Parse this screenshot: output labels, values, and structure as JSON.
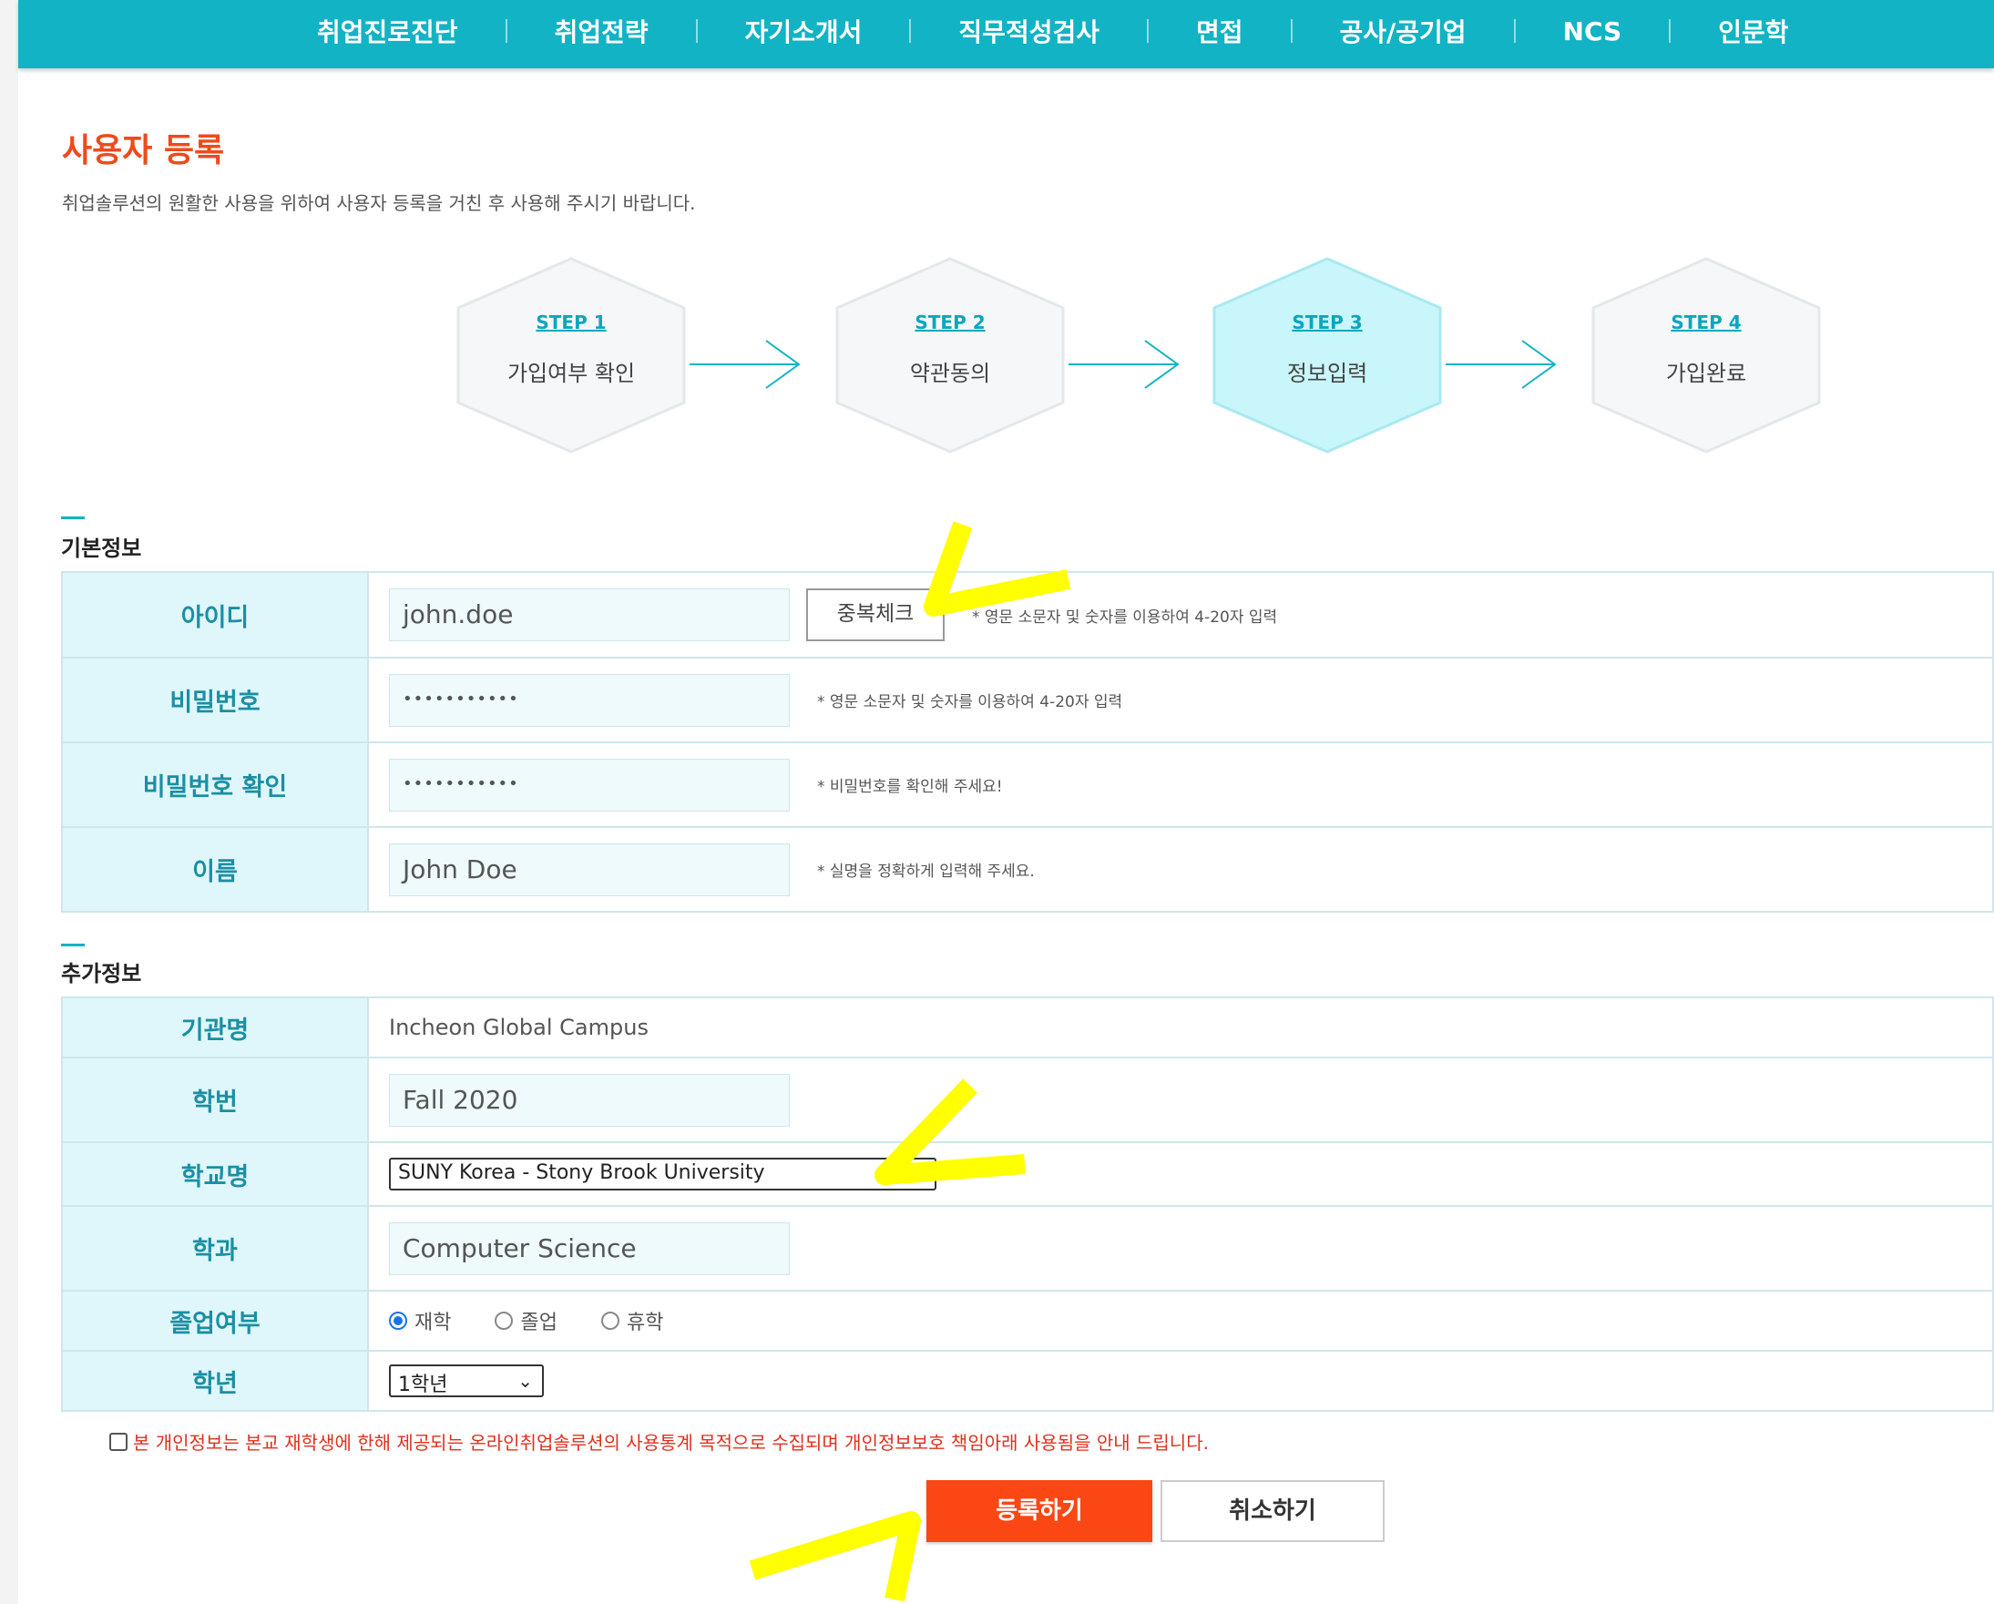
{
  "nav": {
    "items": [
      "취업진로진단",
      "취업전략",
      "자기소개서",
      "직무적성검사",
      "면접",
      "공사/공기업",
      "NCS",
      "인문학"
    ]
  },
  "page": {
    "title": "사용자 등록",
    "description": "취업솔루션의 원활한 사용을 위하여 사용자 등록을 거친 후 사용해 주시기 바랍니다."
  },
  "steps": [
    {
      "step": "STEP 1",
      "label": "가입여부 확인",
      "active": false
    },
    {
      "step": "STEP 2",
      "label": "약관동의",
      "active": false
    },
    {
      "step": "STEP 3",
      "label": "정보입력",
      "active": true
    },
    {
      "step": "STEP 4",
      "label": "가입완료",
      "active": false
    }
  ],
  "basic": {
    "section_title": "기본정보",
    "id_label": "아이디",
    "id_value": "john.doe",
    "dup_check_label": "중복체크",
    "id_note": "* 영문 소문자 및 숫자를 이용하여 4-20자 입력",
    "pw_label": "비밀번호",
    "pw_value": "•••••••••••",
    "pw_note": "* 영문 소문자 및 숫자를 이용하여 4-20자 입력",
    "pw_confirm_label": "비밀번호 확인",
    "pw_confirm_value": "•••••••••••",
    "pw_confirm_note": "* 비밀번호를 확인해 주세요!",
    "name_label": "이름",
    "name_value": "John Doe",
    "name_note": "* 실명을 정확하게 입력해 주세요."
  },
  "extra": {
    "section_title": "추가정보",
    "org_label": "기관명",
    "org_value": "Incheon Global Campus",
    "admission_label": "학번",
    "admission_value": "Fall 2020",
    "school_label": "학교명",
    "school_value": "SUNY Korea - Stony Brook University",
    "major_label": "학과",
    "major_value": "Computer Science",
    "grad_label": "졸업여부",
    "grad_options": [
      "재학",
      "졸업",
      "휴학"
    ],
    "grad_selected": "재학",
    "grade_label": "학년",
    "grade_value": "1학년"
  },
  "agree_text": "본 개인정보는 본교 재학생에 한해 제공되는 온라인취업솔루션의 사용통계 목적으로 수집되며 개인정보보호 책임아래 사용됨을 안내 드립니다.",
  "buttons": {
    "register": "등록하기",
    "cancel": "취소하기"
  },
  "colors": {
    "nav_bg": "#12b3c4",
    "title": "#ef4a1c",
    "register_btn": "#fb4714",
    "header_cell": "#dff7fb",
    "annotation": "#ffff00"
  }
}
